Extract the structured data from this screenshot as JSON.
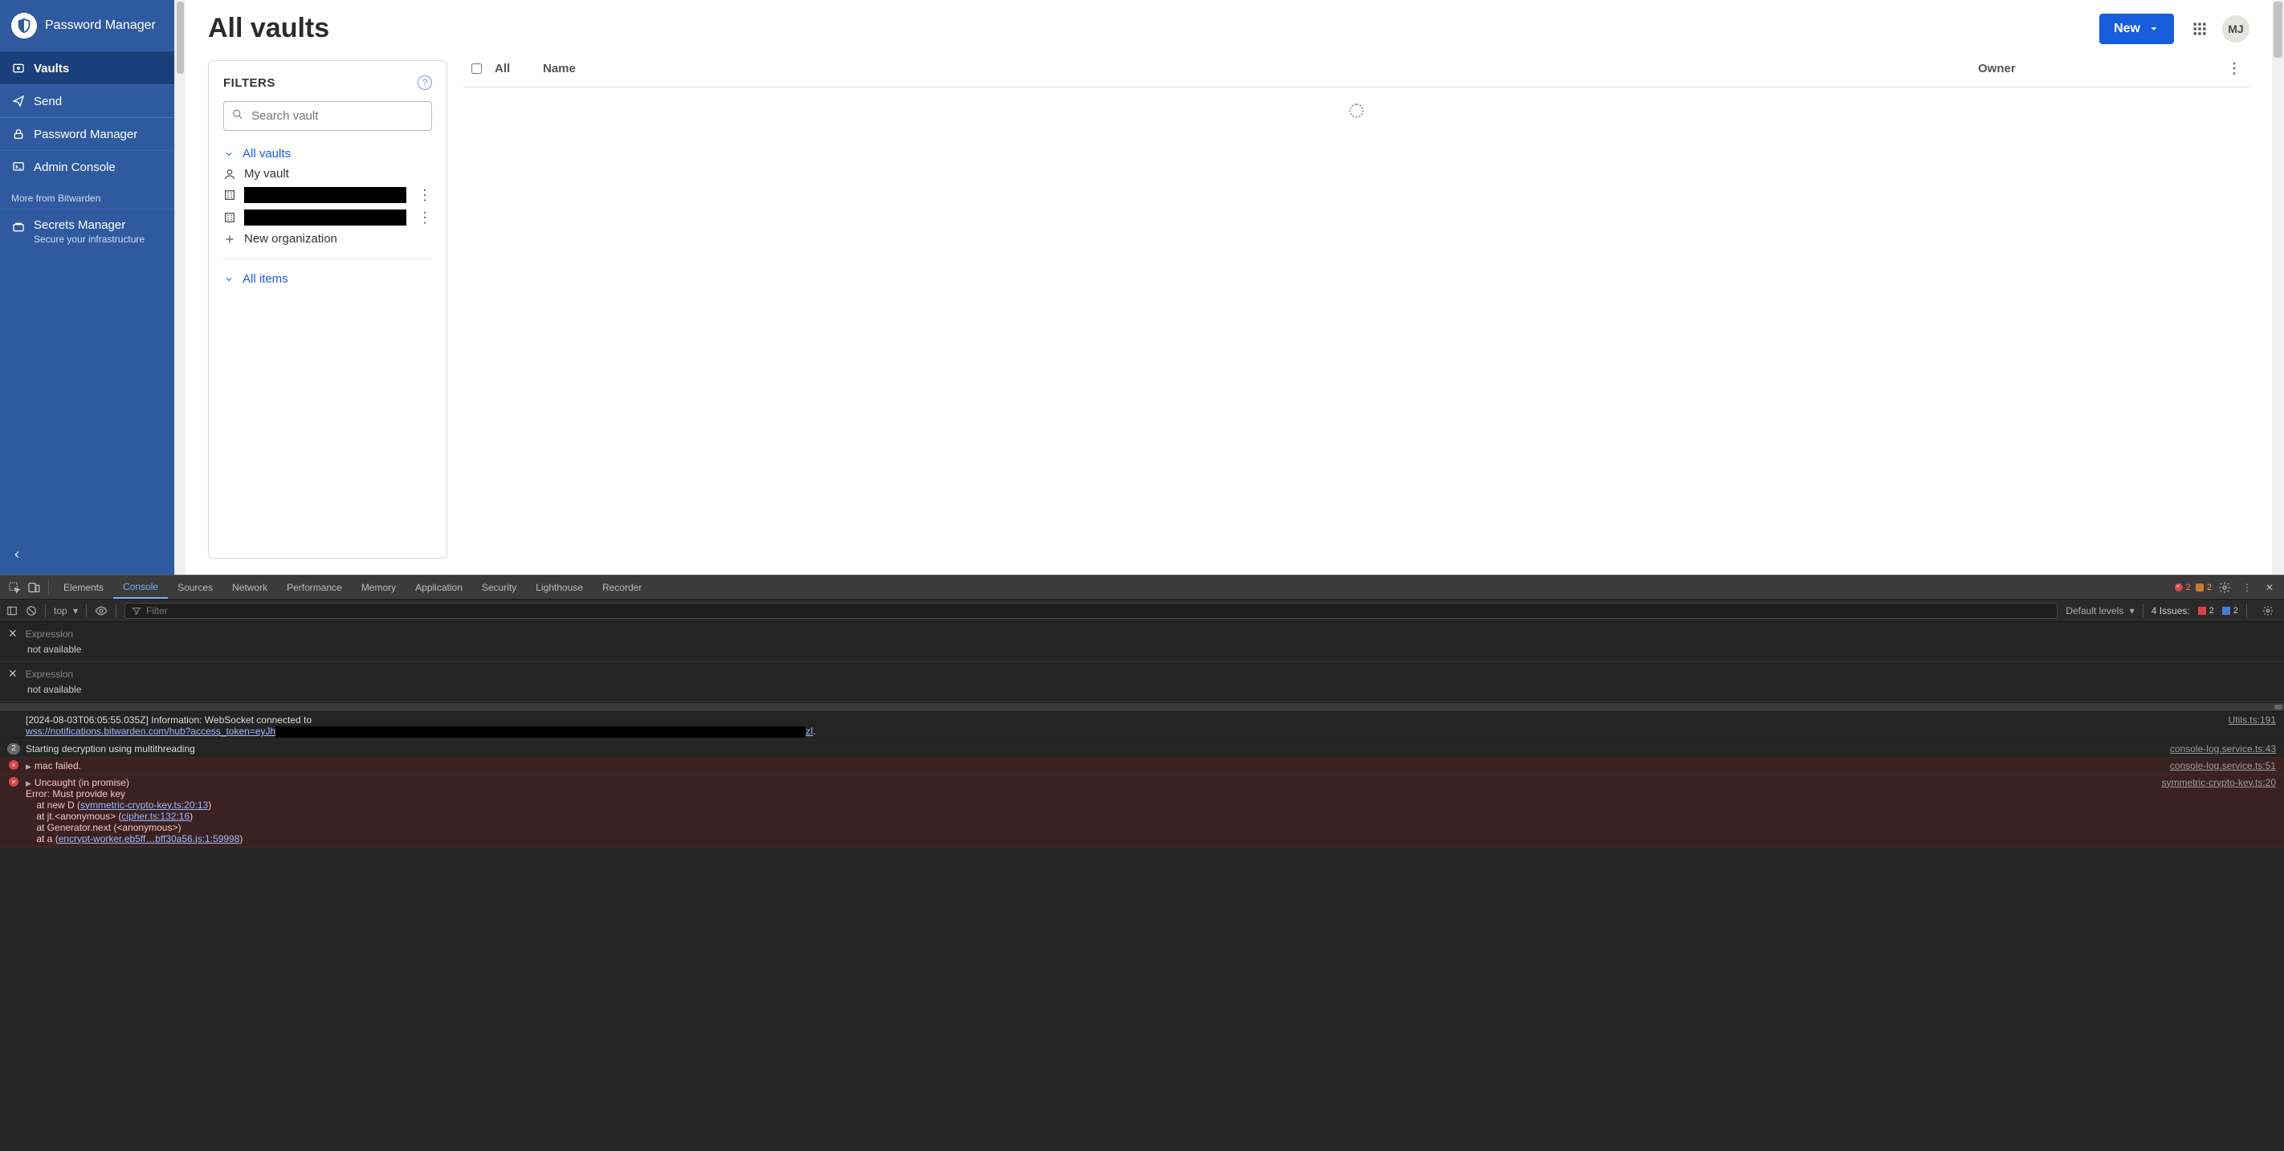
{
  "sidebar": {
    "brand": "Password Manager",
    "items": {
      "vaults": "Vaults",
      "send": "Send",
      "pm": "Password Manager",
      "admin": "Admin Console"
    },
    "more_label": "More from Bitwarden",
    "secrets": {
      "title": "Secrets Manager",
      "sub": "Secure your infrastructure"
    }
  },
  "header": {
    "title": "All vaults",
    "new_btn": "New",
    "avatar": "MJ"
  },
  "filters": {
    "heading": "FILTERS",
    "search_placeholder": "Search vault",
    "all_vaults": "All vaults",
    "my_vault": "My vault",
    "new_org": "New organization",
    "all_items": "All items"
  },
  "table": {
    "col_all": "All",
    "col_name": "Name",
    "col_owner": "Owner"
  },
  "devtools": {
    "tabs": [
      "Elements",
      "Console",
      "Sources",
      "Network",
      "Performance",
      "Memory",
      "Application",
      "Security",
      "Lighthouse",
      "Recorder"
    ],
    "active_tab": "Console",
    "err_count": "2",
    "warn_count": "2",
    "context": "top",
    "filter_placeholder": "Filter",
    "levels": "Default levels",
    "issues_label": "4 Issues:",
    "issues_red": "2",
    "issues_blue": "2",
    "watch": {
      "label": "Expression",
      "value": "not available"
    },
    "logs": {
      "info_prefix": "[2024-08-03T06:05:55.035Z] Information: WebSocket connected to ",
      "info_url": "wss://notifications.bitwarden.com/hub?access_token=eyJh",
      "info_suffix_link": "zI",
      "info_tail": ".",
      "info_src": "Utils.ts:191",
      "decrypt_count": "2",
      "decrypt_msg": "Starting decryption using multithreading",
      "decrypt_src": "console-log.service.ts:43",
      "mac_msg": "mac failed.",
      "mac_src": "console-log.service.ts:51",
      "uncaught_header": "Uncaught (in promise)",
      "uncaught_src": "symmetric-crypto-key.ts:20",
      "err_line1": "Error: Must provide key",
      "err_line2a": "    at new D (",
      "err_line2_link": "symmetric-crypto-key.ts:20:13",
      "err_line2b": ")",
      "err_line3a": "    at jt.<anonymous> (",
      "err_line3_link": "cipher.ts:132:16",
      "err_line3b": ")",
      "err_line4": "    at Generator.next (<anonymous>)",
      "err_line5a": "    at a (",
      "err_line5_link": "encrypt-worker.eb5ff…bff30a56.js:1:59998",
      "err_line5b": ")"
    }
  }
}
